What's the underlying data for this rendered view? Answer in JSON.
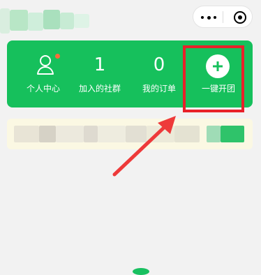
{
  "nav": {
    "capsule_more_icon": "more-dots-icon",
    "capsule_close_icon": "mini-program-close-icon"
  },
  "panel": {
    "bg_color": "#16c05c",
    "items": [
      {
        "icon": "user-icon",
        "label": "个人中心",
        "has_dot": true
      },
      {
        "value": "1",
        "label": "加入的社群"
      },
      {
        "value": "0",
        "label": "我的订单"
      },
      {
        "icon": "plus-circle-icon",
        "label": "一键开团"
      }
    ]
  },
  "annotation": {
    "highlight_color": "#e8212a",
    "arrow_color": "#ee3a3a"
  }
}
